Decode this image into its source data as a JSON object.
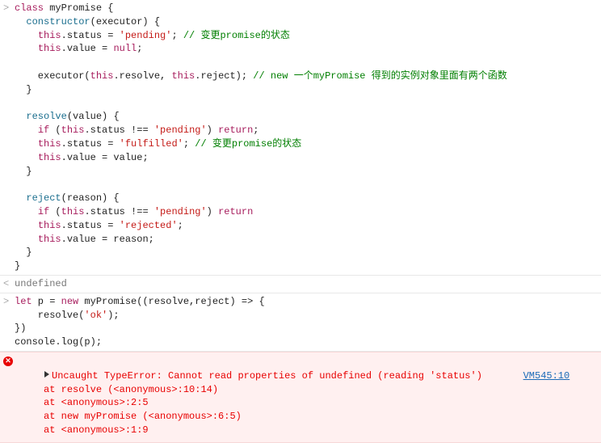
{
  "entries": [
    {
      "type": "input",
      "marker": ">",
      "lines": [
        [
          {
            "t": "class",
            "c": "kw"
          },
          {
            "t": " myPromise {"
          }
        ],
        [
          {
            "t": "  "
          },
          {
            "t": "constructor",
            "c": "def"
          },
          {
            "t": "(executor) {"
          }
        ],
        [
          {
            "t": "    "
          },
          {
            "t": "this",
            "c": "kw"
          },
          {
            "t": ".status = "
          },
          {
            "t": "'pending'",
            "c": "str"
          },
          {
            "t": "; "
          },
          {
            "t": "// 变更promise的状态",
            "c": "comment"
          }
        ],
        [
          {
            "t": "    "
          },
          {
            "t": "this",
            "c": "kw"
          },
          {
            "t": ".value = "
          },
          {
            "t": "null",
            "c": "kw"
          },
          {
            "t": ";"
          }
        ],
        [
          {
            "t": ""
          }
        ],
        [
          {
            "t": "    executor("
          },
          {
            "t": "this",
            "c": "kw"
          },
          {
            "t": ".resolve, "
          },
          {
            "t": "this",
            "c": "kw"
          },
          {
            "t": ".reject); "
          },
          {
            "t": "// new 一个myPromise 得到的实例对象里面有两个函数",
            "c": "comment"
          }
        ],
        [
          {
            "t": "  }"
          }
        ],
        [
          {
            "t": ""
          }
        ],
        [
          {
            "t": "  "
          },
          {
            "t": "resolve",
            "c": "def"
          },
          {
            "t": "(value) {"
          }
        ],
        [
          {
            "t": "    "
          },
          {
            "t": "if",
            "c": "kw"
          },
          {
            "t": " ("
          },
          {
            "t": "this",
            "c": "kw"
          },
          {
            "t": ".status !== "
          },
          {
            "t": "'pending'",
            "c": "str"
          },
          {
            "t": ") "
          },
          {
            "t": "return",
            "c": "kw"
          },
          {
            "t": ";"
          }
        ],
        [
          {
            "t": "    "
          },
          {
            "t": "this",
            "c": "kw"
          },
          {
            "t": ".status = "
          },
          {
            "t": "'fulfilled'",
            "c": "str"
          },
          {
            "t": "; "
          },
          {
            "t": "// 变更promise的状态",
            "c": "comment"
          }
        ],
        [
          {
            "t": "    "
          },
          {
            "t": "this",
            "c": "kw"
          },
          {
            "t": ".value = value;"
          }
        ],
        [
          {
            "t": "  }"
          }
        ],
        [
          {
            "t": ""
          }
        ],
        [
          {
            "t": "  "
          },
          {
            "t": "reject",
            "c": "def"
          },
          {
            "t": "(reason) {"
          }
        ],
        [
          {
            "t": "    "
          },
          {
            "t": "if",
            "c": "kw"
          },
          {
            "t": " ("
          },
          {
            "t": "this",
            "c": "kw"
          },
          {
            "t": ".status !== "
          },
          {
            "t": "'pending'",
            "c": "str"
          },
          {
            "t": ") "
          },
          {
            "t": "return",
            "c": "kw"
          }
        ],
        [
          {
            "t": "    "
          },
          {
            "t": "this",
            "c": "kw"
          },
          {
            "t": ".status = "
          },
          {
            "t": "'rejected'",
            "c": "str"
          },
          {
            "t": ";"
          }
        ],
        [
          {
            "t": "    "
          },
          {
            "t": "this",
            "c": "kw"
          },
          {
            "t": ".value = reason;"
          }
        ],
        [
          {
            "t": "  }"
          }
        ],
        [
          {
            "t": "}"
          }
        ]
      ]
    },
    {
      "type": "output",
      "marker": "<",
      "lines": [
        [
          {
            "t": "undefined",
            "c": "undef"
          }
        ]
      ]
    },
    {
      "type": "input",
      "marker": ">",
      "lines": [
        [
          {
            "t": "let",
            "c": "kw"
          },
          {
            "t": " p = "
          },
          {
            "t": "new",
            "c": "kw"
          },
          {
            "t": " myPromise((resolve,reject) => {"
          }
        ],
        [
          {
            "t": "    resolve("
          },
          {
            "t": "'ok'",
            "c": "str"
          },
          {
            "t": ");"
          }
        ],
        [
          {
            "t": "})"
          }
        ],
        [
          {
            "t": "console.log(p);"
          }
        ]
      ]
    }
  ],
  "error": {
    "message": "Uncaught TypeError: Cannot read properties of undefined (reading 'status')",
    "source": "VM545:10",
    "stack": [
      "at resolve (<anonymous>:10:14)",
      "at <anonymous>:2:5",
      "at new myPromise (<anonymous>:6:5)",
      "at <anonymous>:1:9"
    ]
  }
}
